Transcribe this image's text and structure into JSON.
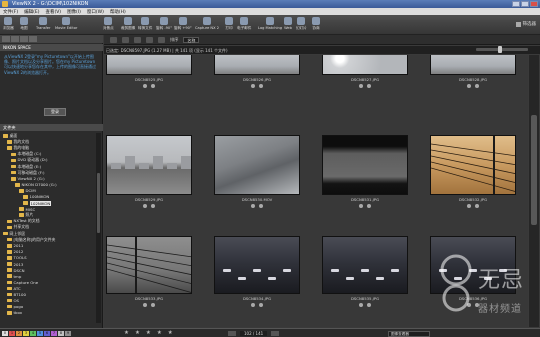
{
  "window": {
    "title": "ViewNX 2 - G:\\DCIM\\102NIKON"
  },
  "menu": [
    "文件(F)",
    "编辑(E)",
    "查看(V)",
    "图像(I)",
    "窗口(W)",
    "帮助(H)"
  ],
  "toolbar": [
    {
      "label": "浏览器",
      "icon": "browser-icon"
    },
    {
      "label": "地图",
      "icon": "map-icon"
    },
    {
      "label": "Transfer",
      "icon": "transfer-icon"
    },
    {
      "label": "Movie Editor",
      "icon": "movie-editor-icon"
    },
    {
      "label": "对焦点",
      "icon": "focus-point-icon"
    },
    {
      "label": "裁剪图像",
      "icon": "crop-icon"
    },
    {
      "label": "转换文件",
      "icon": "convert-icon"
    },
    {
      "label": "旋转 -90°",
      "icon": "rotate-left-icon"
    },
    {
      "label": "旋转 +90°",
      "icon": "rotate-right-icon"
    },
    {
      "label": "Capture NX 2",
      "icon": "capture-nx-icon"
    },
    {
      "label": "打印",
      "icon": "print-icon"
    },
    {
      "label": "电子邮件",
      "icon": "email-icon"
    },
    {
      "label": "Log Matching",
      "icon": "log-matching-icon"
    },
    {
      "label": "Web",
      "icon": "web-icon"
    },
    {
      "label": "幻灯片",
      "icon": "slideshow-icon"
    },
    {
      "label": "协商",
      "icon": "share-icon"
    }
  ],
  "filter_label": "筛选器",
  "left_panel": {
    "nxspace_title": "NIKON SPACE",
    "nxspace_text": "从ViewNX 2登录\"my Picturetown\"以开始上传图像、照片文档以及分享图片。您在my Picturetown可以快速地分享您存在其中，上传的图像可直接通过ViewNX 2的浏览器打开。",
    "login_label": "登录",
    "folder_header": "文件夹",
    "tree": [
      "桌面",
      "我的文档",
      "我的电脑",
      "本地磁盘 (C:)",
      "DVD 驱动器 (D:)",
      "本地磁盘 (E:)",
      "可移动磁盘 (F:)",
      "ViewNX 2 (G:)",
      "NIKON D7000 (G:)",
      "DCIM",
      "100NIKON",
      "102NIKON",
      "MISC",
      "照片",
      "NXTest 的文档",
      "共享文档",
      "网上邻居",
      "[电脑名称]的用户文件夹",
      "2011",
      "2012",
      "TOOLS",
      "2013",
      "DSCN",
      "tmp",
      "Capture One",
      "ATC",
      "BT100",
      "OS",
      "pogo",
      "tbox"
    ],
    "selected_tree_index": 11
  },
  "navbar": {
    "sort_label": "排序",
    "sort_value": "名称"
  },
  "path_text": "已选定: DSCN8597.JPG (1.27 MB) | 共 141 项 (显示 141 个文件)",
  "thumbnails": [
    {
      "name": "DSCN8525.JPG",
      "scene": "sky"
    },
    {
      "name": "DSCN8526.JPG",
      "scene": "sky"
    },
    {
      "name": "DSCN8527.JPG",
      "scene": "sky2"
    },
    {
      "name": "DSCN8528.JPG",
      "scene": "sky"
    },
    {
      "name": "DSCN8529.JPG",
      "scene": "city"
    },
    {
      "name": "DSCN8530.MOV",
      "scene": "highway"
    },
    {
      "name": "DSCN8531.JPG",
      "scene": "road"
    },
    {
      "name": "DSCN8532.JPG",
      "scene": "wires"
    },
    {
      "name": "DSCN8533.JPG",
      "scene": "pole"
    },
    {
      "name": "DSCN8534.JPG",
      "scene": "night"
    },
    {
      "name": "DSCN8535.JPG",
      "scene": "night"
    },
    {
      "name": "DSCN8536.JPG",
      "scene": "night"
    }
  ],
  "status": {
    "labels": [
      "0",
      "1",
      "2",
      "3",
      "4",
      "5",
      "6",
      "7",
      "8",
      "9"
    ],
    "label_colors": [
      "#dddddd",
      "#e05050",
      "#e09040",
      "#e0d040",
      "#60c060",
      "#5090e0",
      "#6060d0",
      "#b060d0",
      "#c0c0c0",
      "#909090"
    ],
    "stars": [
      "★",
      "★",
      "★",
      "★",
      "★"
    ],
    "page_text": "102 / 141",
    "select_value": "图像查看器"
  },
  "watermark": {
    "main": "无忌",
    "sub": "器材频道"
  }
}
